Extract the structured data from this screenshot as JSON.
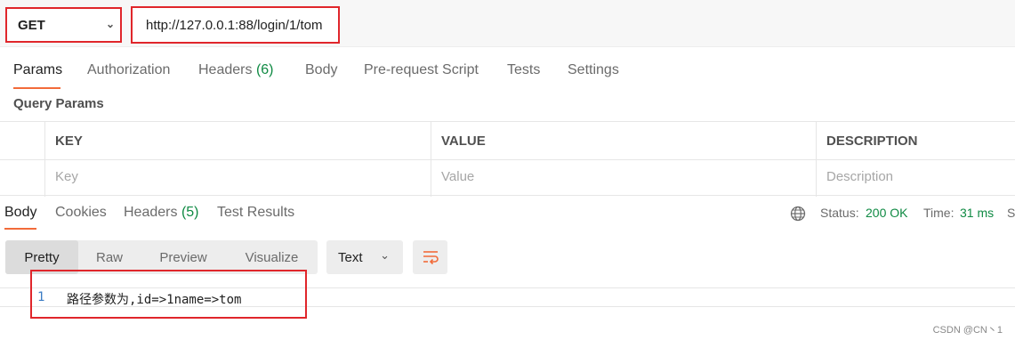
{
  "request": {
    "method": "GET",
    "url": "http://127.0.0.1:88/login/1/tom"
  },
  "request_tabs": {
    "params": "Params",
    "authorization": "Authorization",
    "headers": "Headers",
    "headers_count": "(6)",
    "body": "Body",
    "pre_request_script": "Pre-request Script",
    "tests": "Tests",
    "settings": "Settings"
  },
  "query_params": {
    "title": "Query Params",
    "columns": [
      "KEY",
      "VALUE",
      "DESCRIPTION"
    ],
    "placeholders": [
      "Key",
      "Value",
      "Description"
    ]
  },
  "response_tabs": {
    "body": "Body",
    "cookies": "Cookies",
    "headers": "Headers",
    "headers_count": "(5)",
    "test_results": "Test Results"
  },
  "status": {
    "status_label": "Status:",
    "status_value": "200 OK",
    "time_label": "Time:",
    "time_value": "31 ms",
    "size_label_cut": "S"
  },
  "view_modes": [
    "Pretty",
    "Raw",
    "Preview",
    "Visualize"
  ],
  "format": "Text",
  "output": {
    "line_number": "1",
    "text": "路径参数为,id=>1name=>tom"
  },
  "watermark": "CSDN @CN丶1",
  "colors": {
    "accent": "#f26b3a",
    "highlight_box": "#e0262b",
    "success": "#0f8a43"
  },
  "icons": {
    "method_dropdown": "chevron-down-icon",
    "globe": "globe-icon",
    "format_dropdown": "chevron-down-icon",
    "wrap": "wrap-lines-icon"
  }
}
